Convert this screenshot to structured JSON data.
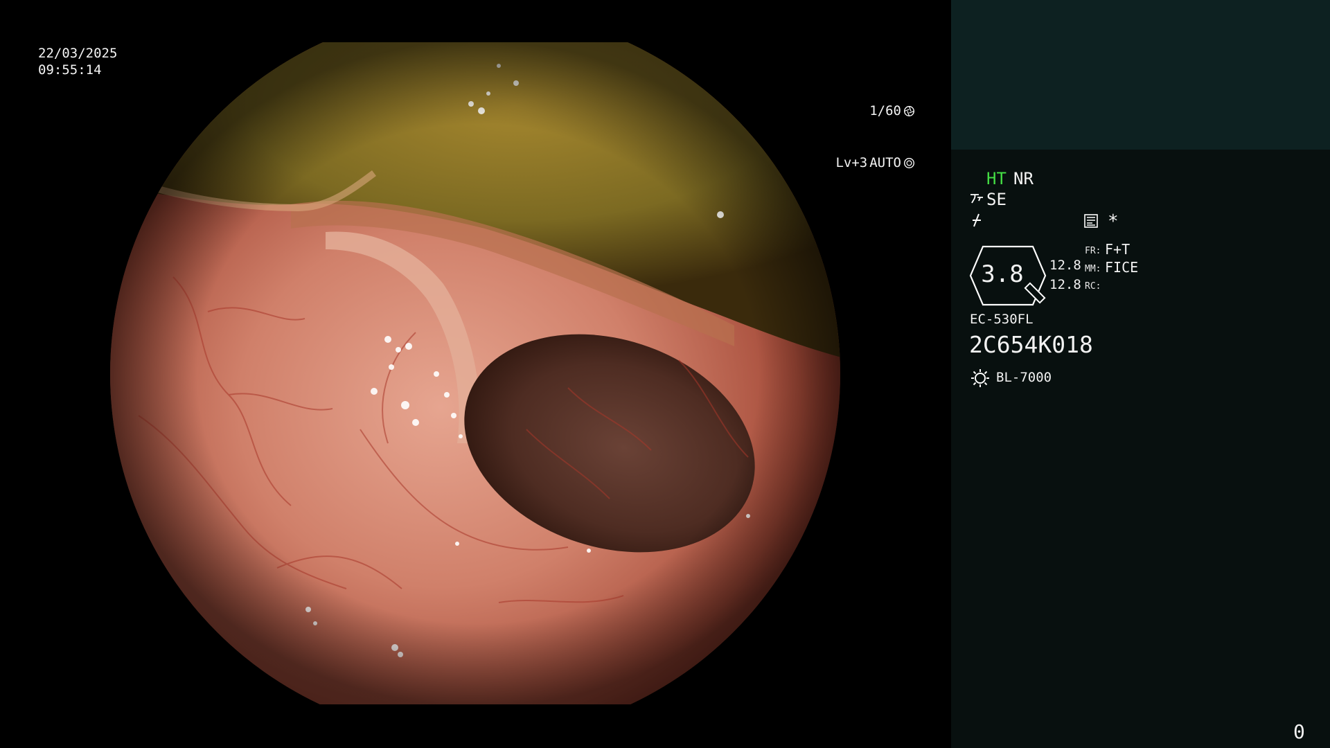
{
  "scope_overlay": {
    "date": "22/03/2025",
    "time": "09:55:14",
    "shutter": "1/60",
    "iris_level": "Lv+3",
    "iris_mode": "AUTO"
  },
  "info_panel": {
    "ht": "HT",
    "nr": "NR",
    "se": "SE",
    "star": "*",
    "magnification": "3.8",
    "value_1": "12.8",
    "value_2": "12.8",
    "fr_label": "FR:",
    "fr_value": "F+T",
    "mm_label": "MM:",
    "mm_value": "FICE",
    "rc_label": "RC:",
    "scope_model": "EC-530FL",
    "scope_serial": "2C654K018",
    "light_source": "BL-7000",
    "counter": "0"
  },
  "colors": {
    "ht_accent": "#44dd44",
    "panel_header": "#0d2121",
    "panel_body": "#08100f",
    "mucosa": "#c66a55"
  },
  "icons": [
    "shutter-icon",
    "iris-icon",
    "scope-tip-icon",
    "bolt-icon",
    "document-icon",
    "lamp-icon"
  ]
}
